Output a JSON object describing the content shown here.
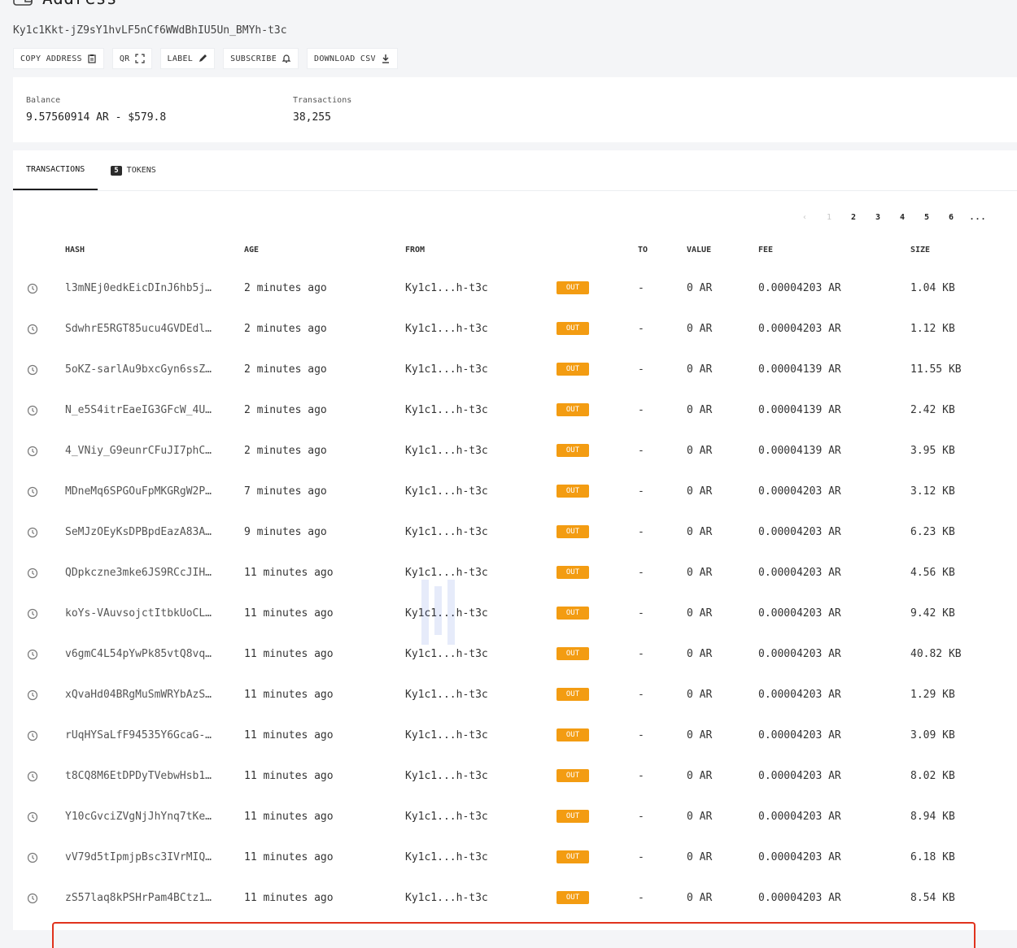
{
  "page": {
    "title": "Address",
    "address": "Ky1c1Kkt-jZ9sY1hvLF5nCf6WWdBhIU5Un_BMYh-t3c"
  },
  "actions": [
    {
      "label": "COPY ADDRESS",
      "icon": "clipboard-icon"
    },
    {
      "label": "QR",
      "icon": "expand-icon"
    },
    {
      "label": "LABEL",
      "icon": "pencil-icon"
    },
    {
      "label": "SUBSCRIBE",
      "icon": "bell-icon"
    },
    {
      "label": "DOWNLOAD CSV",
      "icon": "download-icon"
    }
  ],
  "summary": {
    "balance_label": "Balance",
    "balance_value": "9.57560914 AR - $579.8",
    "tx_label": "Transactions",
    "tx_value": "38,255"
  },
  "tabs": {
    "transactions": "TRANSACTIONS",
    "tokens_count": "5",
    "tokens": "TOKENS"
  },
  "pager": {
    "prev": "‹",
    "pages": [
      "1",
      "2",
      "3",
      "4",
      "5",
      "6"
    ],
    "more": "..."
  },
  "columns": {
    "hash": "HASH",
    "age": "AGE",
    "from": "FROM",
    "to": "TO",
    "value": "VALUE",
    "fee": "FEE",
    "size": "SIZE"
  },
  "rows": [
    {
      "hash": "l3mNEj0edkEicDInJ6hb5j…",
      "age": "2 minutes ago",
      "from": "Ky1c1...h-t3c",
      "dir": "OUT",
      "to": "-",
      "value": "0 AR",
      "fee": "0.00004203 AR",
      "size": "1.04 KB"
    },
    {
      "hash": "SdwhrE5RGT85ucu4GVDEdl…",
      "age": "2 minutes ago",
      "from": "Ky1c1...h-t3c",
      "dir": "OUT",
      "to": "-",
      "value": "0 AR",
      "fee": "0.00004203 AR",
      "size": "1.12 KB"
    },
    {
      "hash": "5oKZ-sarlAu9bxcGyn6ssZ…",
      "age": "2 minutes ago",
      "from": "Ky1c1...h-t3c",
      "dir": "OUT",
      "to": "-",
      "value": "0 AR",
      "fee": "0.00004139 AR",
      "size": "11.55 KB"
    },
    {
      "hash": "N_e5S4itrEaeIG3GFcW_4U…",
      "age": "2 minutes ago",
      "from": "Ky1c1...h-t3c",
      "dir": "OUT",
      "to": "-",
      "value": "0 AR",
      "fee": "0.00004139 AR",
      "size": "2.42 KB"
    },
    {
      "hash": "4_VNiy_G9eunrCFuJI7phC…",
      "age": "2 minutes ago",
      "from": "Ky1c1...h-t3c",
      "dir": "OUT",
      "to": "-",
      "value": "0 AR",
      "fee": "0.00004139 AR",
      "size": "3.95 KB"
    },
    {
      "hash": "MDneMq6SPGOuFpMKGRgW2P…",
      "age": "7 minutes ago",
      "from": "Ky1c1...h-t3c",
      "dir": "OUT",
      "to": "-",
      "value": "0 AR",
      "fee": "0.00004203 AR",
      "size": "3.12 KB"
    },
    {
      "hash": "SeMJzOEyKsDPBpdEazA83A…",
      "age": "9 minutes ago",
      "from": "Ky1c1...h-t3c",
      "dir": "OUT",
      "to": "-",
      "value": "0 AR",
      "fee": "0.00004203 AR",
      "size": "6.23 KB"
    },
    {
      "hash": "QDpkczne3mke6JS9RCcJIH…",
      "age": "11 minutes ago",
      "from": "Ky1c1...h-t3c",
      "dir": "OUT",
      "to": "-",
      "value": "0 AR",
      "fee": "0.00004203 AR",
      "size": "4.56 KB"
    },
    {
      "hash": "koYs-VAuvsojctItbkUoCL…",
      "age": "11 minutes ago",
      "from": "Ky1c1...h-t3c",
      "dir": "OUT",
      "to": "-",
      "value": "0 AR",
      "fee": "0.00004203 AR",
      "size": "9.42 KB"
    },
    {
      "hash": "v6gmC4L54pYwPk85vtQ8vq…",
      "age": "11 minutes ago",
      "from": "Ky1c1...h-t3c",
      "dir": "OUT",
      "to": "-",
      "value": "0 AR",
      "fee": "0.00004203 AR",
      "size": "40.82 KB"
    },
    {
      "hash": "xQvaHd04BRgMuSmWRYbAzS…",
      "age": "11 minutes ago",
      "from": "Ky1c1...h-t3c",
      "dir": "OUT",
      "to": "-",
      "value": "0 AR",
      "fee": "0.00004203 AR",
      "size": "1.29 KB"
    },
    {
      "hash": "rUqHYSaLfF94535Y6GcaG-…",
      "age": "11 minutes ago",
      "from": "Ky1c1...h-t3c",
      "dir": "OUT",
      "to": "-",
      "value": "0 AR",
      "fee": "0.00004203 AR",
      "size": "3.09 KB"
    },
    {
      "hash": "t8CQ8M6EtDPDyTVebwHsb1…",
      "age": "11 minutes ago",
      "from": "Ky1c1...h-t3c",
      "dir": "OUT",
      "to": "-",
      "value": "0 AR",
      "fee": "0.00004203 AR",
      "size": "8.02 KB"
    },
    {
      "hash": "Y10cGvciZVgNjJhYnq7tKe…",
      "age": "11 minutes ago",
      "from": "Ky1c1...h-t3c",
      "dir": "OUT",
      "to": "-",
      "value": "0 AR",
      "fee": "0.00004203 AR",
      "size": "8.94 KB"
    },
    {
      "hash": "vV79d5tIpmjpBsc3IVrMIQ…",
      "age": "11 minutes ago",
      "from": "Ky1c1...h-t3c",
      "dir": "OUT",
      "to": "-",
      "value": "0 AR",
      "fee": "0.00004203 AR",
      "size": "6.18 KB"
    },
    {
      "hash": "zS57laq8kPSHrPam4BCtz1…",
      "age": "11 minutes ago",
      "from": "Ky1c1...h-t3c",
      "dir": "OUT",
      "to": "-",
      "value": "0 AR",
      "fee": "0.00004203 AR",
      "size": "8.54 KB"
    }
  ],
  "colors": {
    "accent_out": "#f39c12",
    "highlight": "#e0331d"
  }
}
